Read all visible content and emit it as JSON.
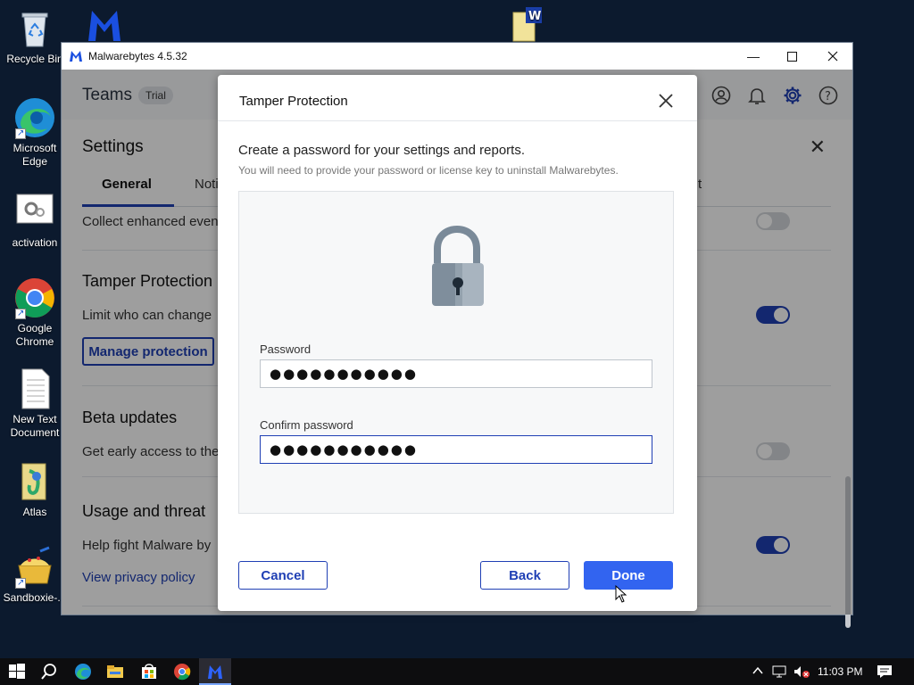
{
  "desktop": {
    "icons": [
      {
        "label": "Recycle Bin",
        "icon": "recycle-bin-icon"
      },
      {
        "label": "Microsoft Edge",
        "icon": "edge-icon"
      },
      {
        "label": "activation",
        "icon": "settings-file-icon"
      },
      {
        "label": "Google Chrome",
        "icon": "chrome-icon"
      },
      {
        "label": "New Text Document",
        "icon": "text-document-icon"
      },
      {
        "label": "Atlas",
        "icon": "atlas-folder-icon"
      },
      {
        "label": "Sandboxie-...",
        "icon": "sandboxie-icon"
      }
    ]
  },
  "window": {
    "title": "Malwarebytes 4.5.32",
    "header": {
      "teams": "Teams",
      "trial": "Trial"
    },
    "settings": {
      "title": "Settings",
      "tabs": [
        {
          "label": "General"
        },
        {
          "label": "Noti"
        },
        {
          "label": "t"
        }
      ],
      "collect_text": "Collect enhanced even",
      "tamper_title": "Tamper Protection",
      "tamper_text": "Limit who can change",
      "manage_button": "Manage protection",
      "beta_title": "Beta updates",
      "beta_text": "Get early access to the",
      "usage_title": "Usage and threat",
      "usage_text": "Help fight Malware by",
      "privacy_link": "View privacy policy",
      "toggles": {
        "collect": false,
        "tamper": true,
        "beta": false,
        "usage": true
      }
    }
  },
  "dialog": {
    "title": "Tamper Protection",
    "heading": "Create a password for your settings and reports.",
    "subtext": "You will need to provide your password or license key to uninstall Malwarebytes.",
    "password_label": "Password",
    "password_value": "●●●●●●●●●●●",
    "confirm_label": "Confirm password",
    "confirm_value": "●●●●●●●●●●●",
    "cancel": "Cancel",
    "back": "Back",
    "done": "Done"
  },
  "taskbar": {
    "time": "11:03 PM",
    "apps": [
      "start-icon",
      "search-icon",
      "edge-icon",
      "file-explorer-icon",
      "store-icon",
      "chrome-icon",
      "malwarebytes-icon"
    ]
  },
  "colors": {
    "accent": "#1f3fb4",
    "primary_button": "#3264f0"
  }
}
